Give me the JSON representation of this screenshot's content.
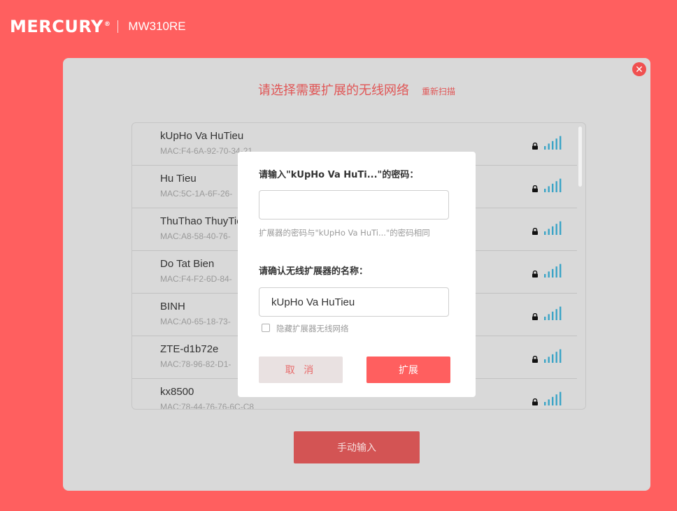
{
  "header": {
    "brand": "MERCURY",
    "brand_mark": "®",
    "model": "MW310RE"
  },
  "panel": {
    "title": "请选择需要扩展的无线网络",
    "rescan_label": "重新扫描",
    "close_icon": "close-icon",
    "manual_button": "手动输入"
  },
  "networks": [
    {
      "ssid": "kUpHo Va HuTieu",
      "mac": "MAC:F4-6A-92-70-34-21",
      "secured": true,
      "signal": 5
    },
    {
      "ssid": "Hu Tieu",
      "mac": "MAC:5C-1A-6F-26-",
      "secured": true,
      "signal": 5
    },
    {
      "ssid": "ThuThao ThuyTie",
      "mac": "MAC:A8-58-40-76-",
      "secured": true,
      "signal": 5
    },
    {
      "ssid": "Do Tat Bien",
      "mac": "MAC:F4-F2-6D-84-",
      "secured": true,
      "signal": 5
    },
    {
      "ssid": "BINH",
      "mac": "MAC:A0-65-18-73-",
      "secured": true,
      "signal": 5
    },
    {
      "ssid": "ZTE-d1b72e",
      "mac": "MAC:78-96-82-D1-",
      "secured": true,
      "signal": 5
    },
    {
      "ssid": "kx8500",
      "mac": "MAC:78-44-76-76-6C-C8",
      "secured": true,
      "signal": 5
    }
  ],
  "modal": {
    "password_label": "请输入\"kUpHo Va HuTi...\"的密码：",
    "password_value": "",
    "password_hint": "扩展器的密码与\"kUpHo Va HuTi...\"的密码相同",
    "name_label": "请确认无线扩展器的名称：",
    "name_value": "kUpHo Va HuTieu",
    "hide_label": "隐藏扩展器无线网络",
    "hide_checked": false,
    "cancel_label": "取 消",
    "extend_label": "扩展"
  },
  "colors": {
    "brand": "#ff5f5f",
    "signal": "#3aa4c6",
    "panel": "#d9d9d9"
  }
}
